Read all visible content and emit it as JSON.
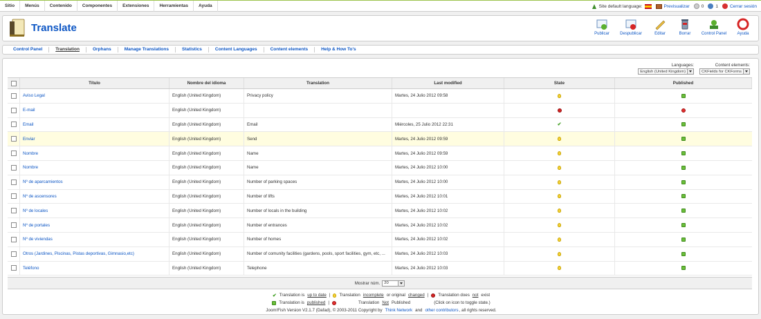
{
  "topbar": {
    "menu": [
      "Sitio",
      "Menús",
      "Contenido",
      "Componentes",
      "Extensiones",
      "Herramientas",
      "Ayuda"
    ],
    "site_language_label": "Site default language:",
    "preview": "Previsualizar",
    "messages_count": "0",
    "users_count": "1",
    "logout": "Cerrar sesión"
  },
  "header": {
    "title": "Translate",
    "toolbar": [
      {
        "label": "Publicar",
        "icon": "publish-icon"
      },
      {
        "label": "Despublicar",
        "icon": "unpublish-icon"
      },
      {
        "label": "Editar",
        "icon": "edit-icon"
      },
      {
        "label": "Borrar",
        "icon": "trash-icon"
      },
      {
        "label": "Control Panel",
        "icon": "control-panel-icon"
      },
      {
        "label": "Ayuda",
        "icon": "help-icon"
      }
    ]
  },
  "submenu": [
    "Control Panel",
    "Translation",
    "Orphans",
    "Manage Translations",
    "Statistics",
    "Content Languages",
    "Content elements",
    "Help & How To's"
  ],
  "filters": {
    "languages_label": "Languages:",
    "languages_value": "English (United Kingdom)",
    "elements_label": "Content elements:",
    "elements_value": "CKFields for CKForms"
  },
  "table": {
    "headers": [
      "Título",
      "Nombre del idioma",
      "Translation",
      "Last modified",
      "State",
      "Published"
    ],
    "rows": [
      {
        "title": "Aviso Legal",
        "lang": "English (United Kingdom)",
        "translation": "Privacy policy",
        "modified": "Martes, 24 Julio 2012 09:58",
        "state": "changed",
        "published": true
      },
      {
        "title": "E-mail",
        "lang": "English (United Kingdom)",
        "translation": "",
        "modified": "",
        "state": "missing",
        "published": false
      },
      {
        "title": "Email",
        "lang": "English (United Kingdom)",
        "translation": "Email",
        "modified": "Miércoles, 25 Julio 2012 22:31",
        "state": "uptodate",
        "published": true
      },
      {
        "title": "Enviar",
        "lang": "English (United Kingdom)",
        "translation": "Send",
        "modified": "Martes, 24 Julio 2012 09:59",
        "state": "changed",
        "published": true
      },
      {
        "title": "Nombre",
        "lang": "English (United Kingdom)",
        "translation": "Name",
        "modified": "Martes, 24 Julio 2012 09:59",
        "state": "changed",
        "published": true
      },
      {
        "title": "Nombre",
        "lang": "English (United Kingdom)",
        "translation": "Name",
        "modified": "Martes, 24 Julio 2012 10:00",
        "state": "changed",
        "published": true
      },
      {
        "title": "Nº de aparcamientos",
        "lang": "English (United Kingdom)",
        "translation": "Number of parking spaces",
        "modified": "Martes, 24 Julio 2012 10:00",
        "state": "changed",
        "published": true
      },
      {
        "title": "Nº de ascensores",
        "lang": "English (United Kingdom)",
        "translation": "Number of lifts",
        "modified": "Martes, 24 Julio 2012 10:01",
        "state": "changed",
        "published": true
      },
      {
        "title": "Nº de locales",
        "lang": "English (United Kingdom)",
        "translation": "Number of locals in the building",
        "modified": "Martes, 24 Julio 2012 10:02",
        "state": "changed",
        "published": true
      },
      {
        "title": "Nº de portales",
        "lang": "English (United Kingdom)",
        "translation": "Number of entrances",
        "modified": "Martes, 24 Julio 2012 10:02",
        "state": "changed",
        "published": true
      },
      {
        "title": "Nº de viviendas",
        "lang": "English (United Kingdom)",
        "translation": "Number of homes",
        "modified": "Martes, 24 Julio 2012 10:02",
        "state": "changed",
        "published": true
      },
      {
        "title": "Otros (Jardines, Piscinas, Pistas deportivas, Gimnasio,etc)",
        "lang": "English (United Kingdom)",
        "translation": "Number of comunity facilities (gardens, pools, sport facilities, gym, etc, ...",
        "modified": "Martes, 24 Julio 2012 10:03",
        "state": "changed",
        "published": true
      },
      {
        "title": "Teléfono",
        "lang": "English (United Kingdom)",
        "translation": "Telephone",
        "modified": "Martes, 24 Julio 2012 10:03",
        "state": "changed",
        "published": true
      }
    ]
  },
  "pagination": {
    "label": "Mostrar núm.",
    "value": "20"
  },
  "legend": {
    "l1_a": "Translation is",
    "l1_b": "up to date",
    "l1_c": "Translation",
    "l1_d": "incomplete",
    "l1_e": "or original",
    "l1_f": "changed",
    "l1_g": "Translation does",
    "l1_h": "not",
    "l1_i": "exist",
    "l2_a": "Translation is",
    "l2_b": "published",
    "l2_c": "Translation",
    "l2_d": "Not",
    "l2_e": "Published",
    "l2_f": "(Click on icon to toggle state.)",
    "l3_a": "Joom!Fish Version V2.1.7 (Dafad), © 2003-2011 Copyright by",
    "l3_b": "Think Network",
    "l3_c": "and",
    "l3_d": "other contributors",
    "l3_e": ", all rights reserved."
  }
}
